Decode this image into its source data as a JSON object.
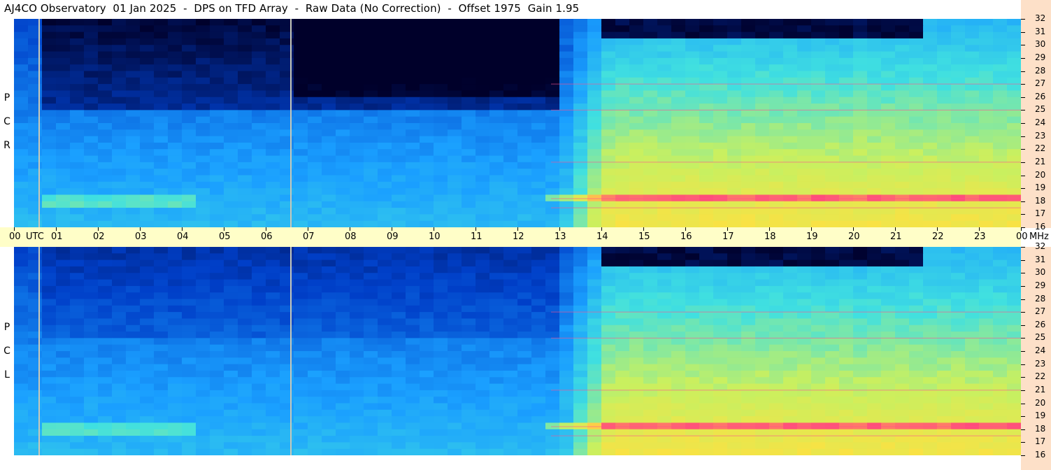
{
  "title": "AJ4CO Observatory  01 Jan 2025  -  DPS on TFD Array  -  Raw Data (No Correction)  -  Offset 1975  Gain 1.95",
  "panels": {
    "rcp_letters": [
      "R",
      "C",
      "P"
    ],
    "lcp_letters": [
      "L",
      "C",
      "P"
    ]
  },
  "chart_data": {
    "type": "heatmap",
    "title": "AJ4CO Observatory  01 Jan 2025  -  DPS on TFD Array  -  Raw Data (No Correction)  -  Offset 1975  Gain 1.95",
    "x": {
      "label": "UTC",
      "range": [
        0,
        24
      ],
      "tick_labels": [
        "00",
        "01",
        "02",
        "03",
        "04",
        "05",
        "06",
        "07",
        "08",
        "09",
        "10",
        "11",
        "12",
        "13",
        "14",
        "15",
        "16",
        "17",
        "18",
        "19",
        "20",
        "21",
        "22",
        "23",
        "00"
      ]
    },
    "y": {
      "label": "MHz",
      "range": [
        16,
        32
      ],
      "tick_labels": [
        "32",
        "31",
        "30",
        "29",
        "28",
        "27",
        "26",
        "25",
        "24",
        "23",
        "22",
        "21",
        "20",
        "19",
        "18",
        "17",
        "16"
      ]
    },
    "series": [
      {
        "name": "RCP",
        "letters": "R C P"
      },
      {
        "name": "LCP",
        "letters": "L C P"
      }
    ],
    "colormap": [
      "#00002a",
      "#003fc8",
      "#1a9fff",
      "#40e0e0",
      "#c8f060",
      "#ffe040",
      "#ff4080"
    ],
    "vertical_markers_utc": [
      0.6,
      6.6
    ],
    "active_period_utc": [
      13.0,
      24.0
    ],
    "quiet_period_utc": [
      13.85,
      21.75
    ],
    "interference_bands_mhz": [
      27,
      25,
      21,
      17.5,
      18.2
    ]
  }
}
